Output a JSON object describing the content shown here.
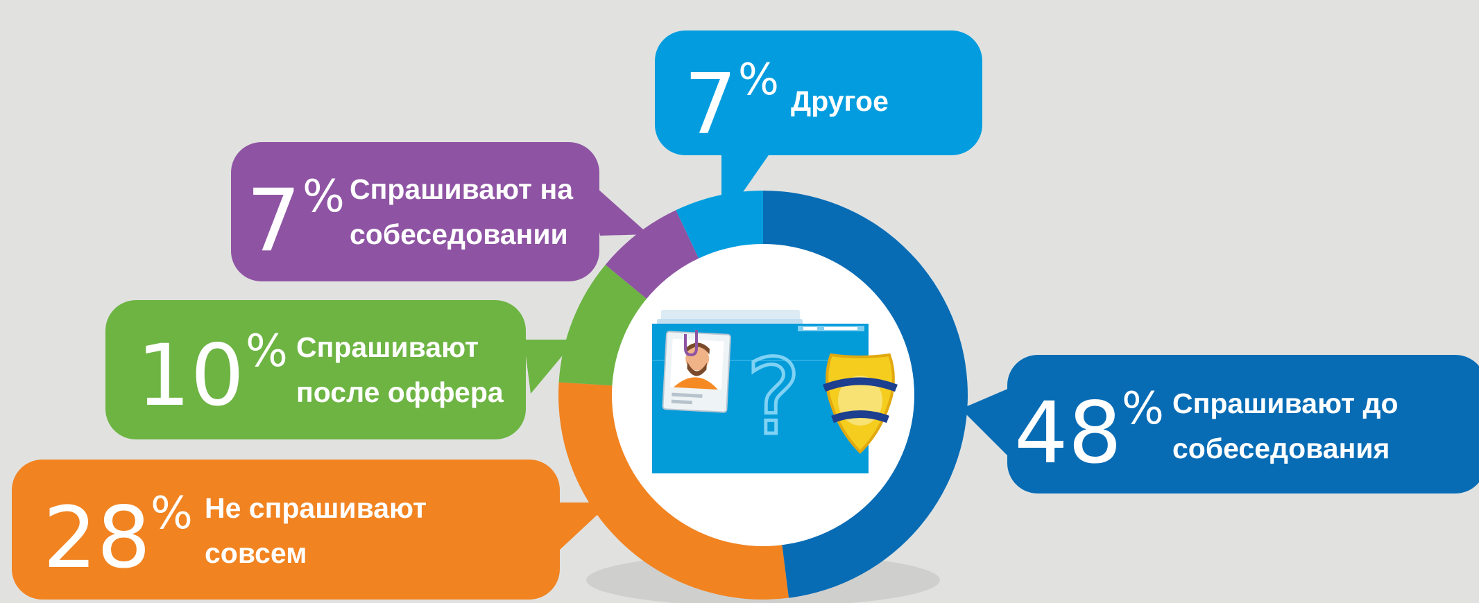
{
  "chart_data": {
    "type": "donut",
    "unit": "%",
    "slices": [
      {
        "value": 48,
        "label": "Спрашивают до собеседования",
        "color": "#086cb5"
      },
      {
        "value": 28,
        "label": "Не спрашивают совсем",
        "color": "#f18321"
      },
      {
        "value": 10,
        "label": "Спрашивают после оффера",
        "color": "#6db443"
      },
      {
        "value": 7,
        "label": "Спрашивают  на собеседовании",
        "color": "#8e54a3"
      },
      {
        "value": 7,
        "label": "Другое",
        "color": "#039ddf"
      }
    ]
  },
  "callouts": {
    "other": {
      "number": "7",
      "percent": "%",
      "label": "Другое"
    },
    "interview": {
      "number": "7",
      "percent": "%",
      "label": "Спрашивают  на\nсобеседовании"
    },
    "after_offer": {
      "number": "10",
      "percent": "%",
      "label": "Спрашивают\nпосле оффера"
    },
    "not_asked": {
      "number": "28",
      "percent": "%",
      "label": "Не спрашивают\nсовсем"
    },
    "before_interview": {
      "number": "48",
      "percent": "%",
      "label": "Спрашивают до\nсобеседования"
    }
  },
  "center_icon": {
    "name": "background-check-icon"
  }
}
